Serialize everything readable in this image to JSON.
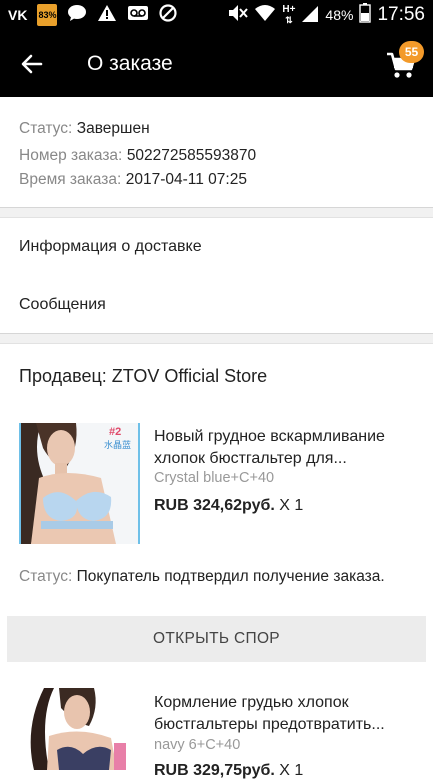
{
  "statusbar": {
    "vk": "VK",
    "battery_small": "83%",
    "signal_type": "H+",
    "battery_percent": "48%",
    "time": "17:56"
  },
  "appbar": {
    "title": "О заказе",
    "cart_count": "55"
  },
  "order": {
    "status_label": "Статус:",
    "status_value": "Завершен",
    "number_label": "Номер заказа:",
    "number_value": "502272585593870",
    "time_label": "Время заказа:",
    "time_value": "2017-04-11 07:25"
  },
  "menu": {
    "delivery": "Информация о доставке",
    "messages": "Сообщения"
  },
  "seller": "Продавец: ZTOV Official Store",
  "products": [
    {
      "title": "Новый грудное вскармливание хлопок бюстгальтер для...",
      "variant": "Crystal blue+C+40",
      "price": "RUB 324,62руб.",
      "qty": "X 1",
      "badge_num": "#2",
      "badge_text": "水晶蓝"
    },
    {
      "title": "Кормление грудью хлопок бюстгальтеры предотвратить...",
      "variant": "navy 6+C+40",
      "price": "RUB 329,75руб.",
      "qty": "X 1"
    }
  ],
  "item_status": {
    "label": "Статус:",
    "value": "Покупатель подтвердил получение заказа."
  },
  "dispute_button": "ОТКРЫТЬ СПОР",
  "colors": {
    "appbar": "#000000",
    "badge": "#f39a2a",
    "dispute_bg": "#ececec"
  }
}
